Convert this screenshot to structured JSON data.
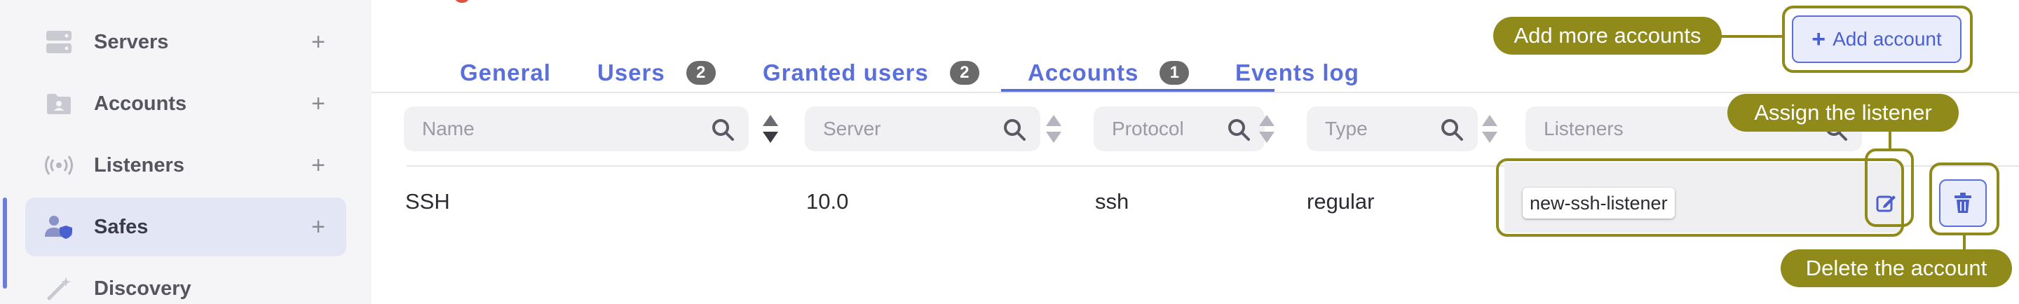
{
  "sidebar": {
    "items": [
      {
        "label": "Servers",
        "icon": "server-icon"
      },
      {
        "label": "Accounts",
        "icon": "folder-icon"
      },
      {
        "label": "Listeners",
        "icon": "broadcast-icon"
      },
      {
        "label": "Safes",
        "icon": "user-shield-icon"
      },
      {
        "label": "Discovery",
        "icon": "magic-wand-icon"
      }
    ],
    "plus": "+"
  },
  "tabs": [
    {
      "label": "General",
      "badge": null
    },
    {
      "label": "Users",
      "badge": "2"
    },
    {
      "label": "Granted users",
      "badge": "2"
    },
    {
      "label": "Accounts",
      "badge": "1"
    },
    {
      "label": "Events log",
      "badge": null
    }
  ],
  "filters": {
    "name": "Name",
    "server": "Server",
    "protocol": "Protocol",
    "type": "Type",
    "listeners": "Listeners"
  },
  "row": {
    "name": "SSH",
    "server": "10.0",
    "protocol": "ssh",
    "type": "regular",
    "listener": "new-ssh-listener"
  },
  "actions": {
    "add_account_plus": "+",
    "add_account": "Add account"
  },
  "annotations": {
    "add_more": "Add more accounts",
    "assign_listener": "Assign the listener",
    "delete_account": "Delete the account"
  },
  "colors": {
    "accent": "#5b6fd8",
    "annotation": "#8f8a1a",
    "sidebar_bg": "#f5f5f7",
    "active_bg": "#e3e6f5"
  }
}
